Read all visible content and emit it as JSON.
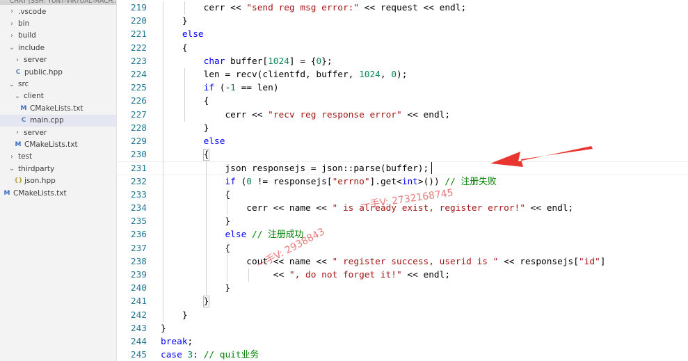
{
  "sidebar": {
    "header": "CHAT [SSH: YUNT-VIRTUAL-MACH...",
    "items": [
      {
        "kind": "folder",
        "state": "collapsed",
        "label": ".vscode"
      },
      {
        "kind": "folder",
        "state": "collapsed",
        "label": "bin"
      },
      {
        "kind": "folder",
        "state": "collapsed",
        "label": "build"
      },
      {
        "kind": "folder",
        "state": "expanded",
        "label": "include"
      },
      {
        "kind": "folder",
        "state": "collapsed",
        "label": "server"
      },
      {
        "kind": "file",
        "icon": "C",
        "label": "public.hpp"
      },
      {
        "kind": "folder",
        "state": "expanded",
        "label": "src"
      },
      {
        "kind": "folder",
        "state": "expanded",
        "label": "client"
      },
      {
        "kind": "file",
        "icon": "M",
        "label": "CMakeLists.txt"
      },
      {
        "kind": "file",
        "icon": "C",
        "label": "main.cpp",
        "selected": true
      },
      {
        "kind": "folder",
        "state": "collapsed",
        "label": "server"
      },
      {
        "kind": "file",
        "icon": "M",
        "label": "CMakeLists.txt"
      },
      {
        "kind": "folder",
        "state": "collapsed",
        "label": "test"
      },
      {
        "kind": "folder",
        "state": "expanded",
        "label": "thirdparty"
      },
      {
        "kind": "file",
        "icon": "{}",
        "label": "json.hpp"
      },
      {
        "kind": "file",
        "icon": "M",
        "label": "CMakeLists.txt"
      }
    ]
  },
  "editor": {
    "file": "main.cpp",
    "current_line": 231,
    "lines": [
      {
        "n": "219",
        "t": [
          [
            "",
            "        cerr << "
          ],
          [
            "str",
            "\"send reg msg error:\""
          ],
          [
            "",
            " << request << endl;"
          ]
        ]
      },
      {
        "n": "220",
        "t": [
          [
            "",
            "    }"
          ]
        ]
      },
      {
        "n": "221",
        "t": [
          [
            "kw",
            "    else"
          ]
        ]
      },
      {
        "n": "222",
        "t": [
          [
            "",
            "    {"
          ]
        ]
      },
      {
        "n": "223",
        "t": [
          [
            "kw",
            "        char"
          ],
          [
            "",
            " buffer["
          ],
          [
            "num",
            "1024"
          ],
          [
            "",
            "] = {"
          ],
          [
            "num",
            "0"
          ],
          [
            "",
            "};"
          ]
        ]
      },
      {
        "n": "224",
        "t": [
          [
            "",
            "        len = recv(clientfd, buffer, "
          ],
          [
            "num",
            "1024"
          ],
          [
            "",
            ", "
          ],
          [
            "num",
            "0"
          ],
          [
            "",
            ");"
          ]
        ]
      },
      {
        "n": "225",
        "t": [
          [
            "kw",
            "        if"
          ],
          [
            "",
            " (-"
          ],
          [
            "num",
            "1"
          ],
          [
            "",
            " == len)"
          ]
        ]
      },
      {
        "n": "226",
        "t": [
          [
            "",
            "        {"
          ]
        ]
      },
      {
        "n": "227",
        "t": [
          [
            "",
            "            cerr << "
          ],
          [
            "str",
            "\"recv reg response error\""
          ],
          [
            "",
            " << endl;"
          ]
        ]
      },
      {
        "n": "228",
        "t": [
          [
            "",
            "        }"
          ]
        ]
      },
      {
        "n": "229",
        "t": [
          [
            "kw",
            "        else"
          ]
        ]
      },
      {
        "n": "230",
        "t": [
          [
            "",
            "        {"
          ]
        ]
      },
      {
        "n": "231",
        "t": [
          [
            "",
            "            json responsejs = json::parse(buffer);"
          ]
        ]
      },
      {
        "n": "232",
        "t": [
          [
            "kw",
            "            if"
          ],
          [
            "",
            " ("
          ],
          [
            "num",
            "0"
          ],
          [
            "",
            " != responsejs["
          ],
          [
            "str",
            "\"errno\""
          ],
          [
            "",
            "].get<"
          ],
          [
            "kw",
            "int"
          ],
          [
            "",
            ">()) "
          ],
          [
            "cmt",
            "// 注册失败"
          ]
        ]
      },
      {
        "n": "233",
        "t": [
          [
            "",
            "            {"
          ]
        ]
      },
      {
        "n": "234",
        "t": [
          [
            "",
            "                cerr << name << "
          ],
          [
            "str",
            "\" is already exist, register error!\""
          ],
          [
            "",
            " << endl;"
          ]
        ]
      },
      {
        "n": "235",
        "t": [
          [
            "",
            "            }"
          ]
        ]
      },
      {
        "n": "236",
        "t": [
          [
            "kw",
            "            else"
          ],
          [
            "",
            " "
          ],
          [
            "cmt",
            "// 注册成功"
          ]
        ]
      },
      {
        "n": "237",
        "t": [
          [
            "",
            "            {"
          ]
        ]
      },
      {
        "n": "238",
        "t": [
          [
            "",
            "                cout << name << "
          ],
          [
            "str",
            "\" register success, userid is \""
          ],
          [
            "",
            " << responsejs["
          ],
          [
            "str",
            "\"id\""
          ],
          [
            "",
            "]"
          ]
        ]
      },
      {
        "n": "239",
        "t": [
          [
            "",
            "                     << "
          ],
          [
            "str",
            "\", do not forget it!\""
          ],
          [
            "",
            " << endl;"
          ]
        ]
      },
      {
        "n": "240",
        "t": [
          [
            "",
            "            }"
          ]
        ]
      },
      {
        "n": "241",
        "t": [
          [
            "",
            "        }"
          ]
        ]
      },
      {
        "n": "242",
        "t": [
          [
            "",
            "    }"
          ]
        ]
      },
      {
        "n": "243",
        "t": [
          [
            "",
            "}"
          ]
        ]
      },
      {
        "n": "244",
        "t": [
          [
            "kw",
            "break"
          ],
          [
            "",
            ";"
          ]
        ]
      },
      {
        "n": "245",
        "t": [
          [
            "kw",
            "case"
          ],
          [
            "",
            " "
          ],
          [
            "num",
            "3"
          ],
          [
            "",
            ": "
          ],
          [
            "cmt",
            "// quit业务"
          ]
        ]
      }
    ]
  },
  "overlays": {
    "watermark_1": "一手V: 2732168745",
    "watermark_2": "一手V: 2938843",
    "arrow_color": "#e8352f"
  }
}
